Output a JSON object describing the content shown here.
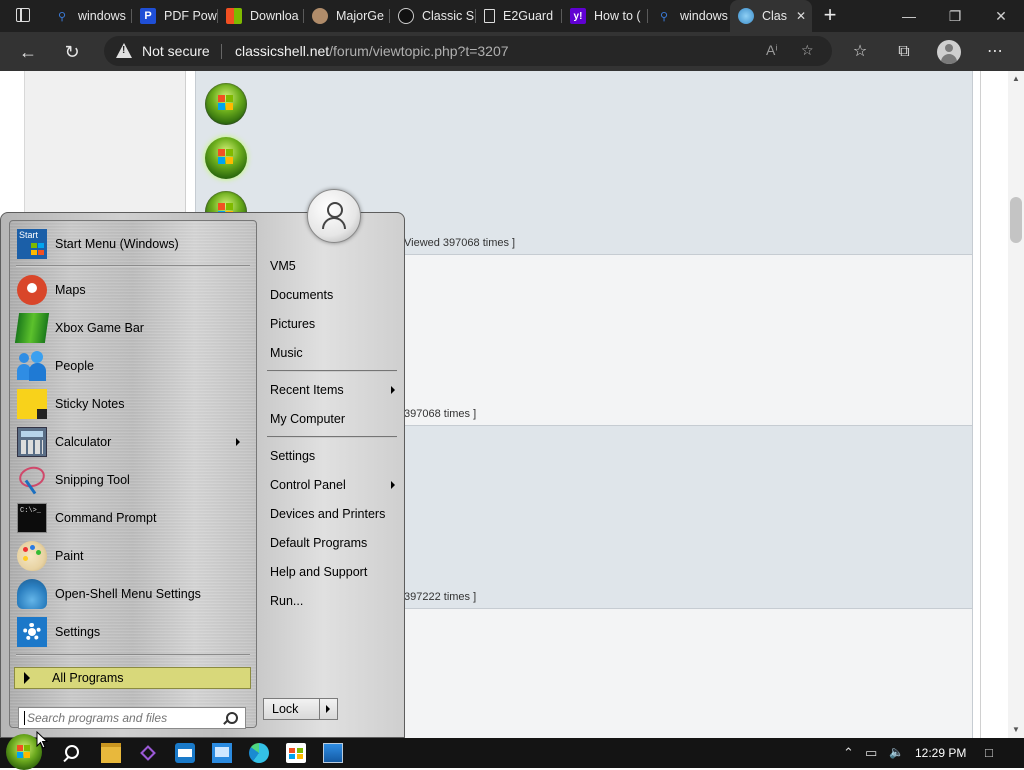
{
  "browser": {
    "tabs": [
      {
        "label": "windows",
        "icon": "search-icon",
        "color": "#3b7bd9"
      },
      {
        "label": "PDF Pow",
        "icon": "pdf-icon",
        "color": "#1f4fd6"
      },
      {
        "label": "Downloa",
        "icon": "windows-logo-icon",
        "color": "#f25022"
      },
      {
        "label": "MajorGe",
        "icon": "majorgeeks-icon",
        "color": "#b08c6a"
      },
      {
        "label": "Classic S",
        "icon": "github-icon",
        "color": "#333333"
      },
      {
        "label": "E2Guard",
        "icon": "page-icon",
        "color": "#dddddd"
      },
      {
        "label": "How to (",
        "icon": "yahoo-icon",
        "color": "#6001d2"
      },
      {
        "label": "windows",
        "icon": "search-icon",
        "color": "#3b7bd9"
      },
      {
        "label": "Clas",
        "icon": "globe-icon",
        "color": "#4aa3df",
        "active": true
      }
    ],
    "new_tab": "+",
    "window_controls": {
      "minimize": "—",
      "restore": "❐",
      "close": "✕"
    },
    "address": {
      "security": "Not secure",
      "host": "classicshell.net",
      "path": "/forum/viewtopic.php?t=3207"
    },
    "tab_close": "✕"
  },
  "page": {
    "rows": [
      {
        "views": "Viewed 397068 times ]"
      },
      {
        "views": "397068 times ]"
      },
      {
        "views": "397222 times ]"
      }
    ]
  },
  "start_menu": {
    "left_items": [
      {
        "label": "Start Menu (Windows)",
        "icon": "start-menu-tile-icon"
      },
      {
        "label": "Maps",
        "icon": "maps-icon"
      },
      {
        "label": "Xbox Game Bar",
        "icon": "xbox-game-bar-icon"
      },
      {
        "label": "People",
        "icon": "people-icon"
      },
      {
        "label": "Sticky Notes",
        "icon": "sticky-notes-icon"
      },
      {
        "label": "Calculator",
        "icon": "calculator-icon",
        "submenu": true
      },
      {
        "label": "Snipping Tool",
        "icon": "snipping-tool-icon"
      },
      {
        "label": "Command Prompt",
        "icon": "command-prompt-icon"
      },
      {
        "label": "Paint",
        "icon": "paint-icon"
      },
      {
        "label": "Open-Shell Menu Settings",
        "icon": "open-shell-icon"
      },
      {
        "label": "Settings",
        "icon": "settings-gear-icon"
      }
    ],
    "start_tile_text": "Start",
    "all_programs": "All Programs",
    "search_placeholder": "Search programs and files",
    "right_items": [
      {
        "label": "VM5"
      },
      {
        "label": "Documents"
      },
      {
        "label": "Pictures"
      },
      {
        "label": "Music"
      },
      {
        "label": "Recent Items",
        "submenu": true
      },
      {
        "label": "My Computer"
      },
      {
        "label": "Settings"
      },
      {
        "label": "Control Panel",
        "submenu": true
      },
      {
        "label": "Devices and Printers"
      },
      {
        "label": "Default Programs"
      },
      {
        "label": "Help and Support"
      },
      {
        "label": "Run..."
      }
    ],
    "lock": "Lock"
  },
  "taskbar": {
    "clock": "12:29 PM",
    "apps": [
      "search-icon",
      "file-explorer-icon",
      "visual-studio-icon",
      "app-icon",
      "control-panel-icon",
      "edge-icon",
      "store-icon",
      "remote-desktop-icon"
    ]
  }
}
